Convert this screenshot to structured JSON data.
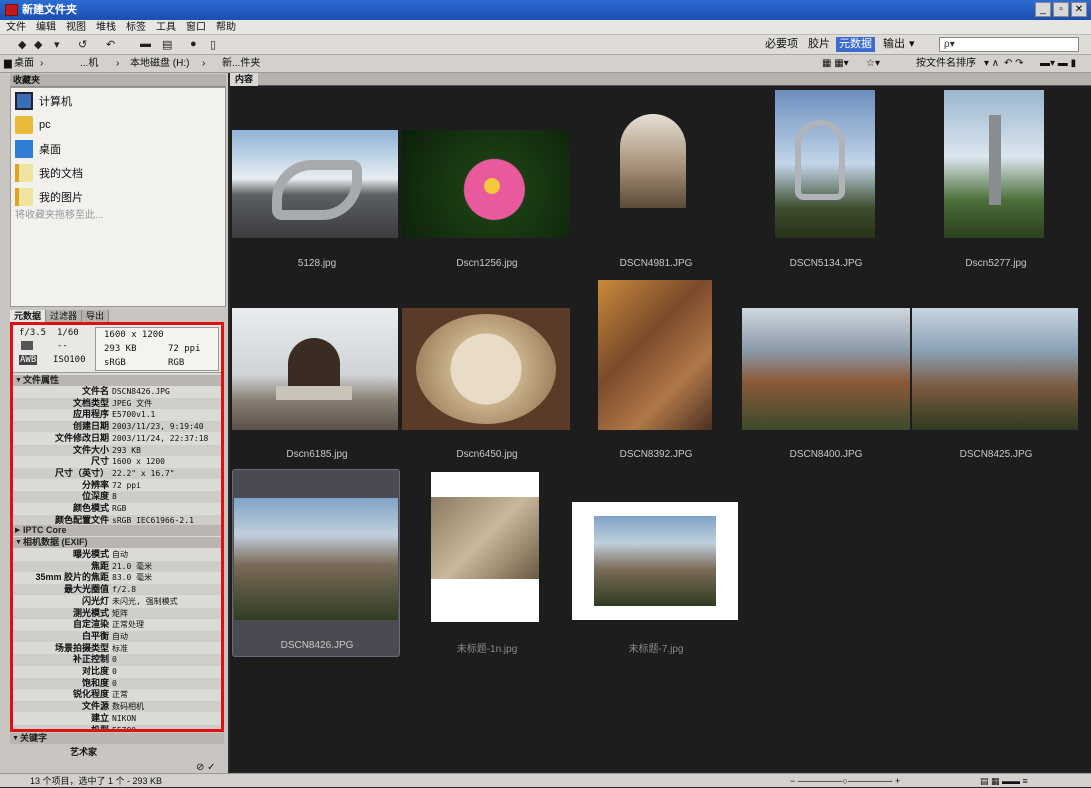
{
  "window": {
    "title": "新建文件夹"
  },
  "menu": [
    "文件",
    "编辑",
    "视图",
    "堆栈",
    "标签",
    "工具",
    "窗口",
    "帮助"
  ],
  "workspaces": [
    {
      "label": "必要项",
      "active": false
    },
    {
      "label": "胶片",
      "active": false
    },
    {
      "label": "元数据",
      "active": true
    },
    {
      "label": "输出",
      "active": false
    }
  ],
  "sort_label": "按文件名排序",
  "path": [
    "桌面",
    "...机",
    "本地磁盘 (H:)",
    "新...件夹"
  ],
  "favorites": {
    "title": "收藏夹",
    "items": [
      {
        "label": "计算机",
        "icon": "computer-icon"
      },
      {
        "label": "pc",
        "icon": "folder-icon"
      },
      {
        "label": "桌面",
        "icon": "desktop-icon"
      },
      {
        "label": "我的文档",
        "icon": "documents-icon"
      },
      {
        "label": "我的图片",
        "icon": "pictures-icon"
      }
    ],
    "hint": "将收藏夹拖移至此..."
  },
  "meta_tabs": [
    {
      "label": "元数据",
      "active": true
    },
    {
      "label": "过滤器",
      "active": false
    },
    {
      "label": "导出",
      "active": false
    }
  ],
  "camera_summary": {
    "aperture": "f/3.5",
    "shutter": "1/60",
    "dash": "--",
    "wb": "AWB",
    "iso": "ISO100",
    "dims": "1600 x 1200",
    "size": "293 KB",
    "ppi": "72 ppi",
    "colorspace": "sRGB",
    "mode": "RGB"
  },
  "file_props": {
    "title": "文件属性",
    "rows": [
      {
        "k": "文件名",
        "v": "DSCN8426.JPG"
      },
      {
        "k": "文档类型",
        "v": "JPEG 文件"
      },
      {
        "k": "应用程序",
        "v": "E5700v1.1"
      },
      {
        "k": "创建日期",
        "v": "2003/11/23, 9:19:40"
      },
      {
        "k": "文件修改日期",
        "v": "2003/11/24, 22:37:18"
      },
      {
        "k": "文件大小",
        "v": "293 KB"
      },
      {
        "k": "尺寸",
        "v": "1600 x 1200"
      },
      {
        "k": "尺寸（英寸）",
        "v": "22.2\" x 16.7\""
      },
      {
        "k": "分辨率",
        "v": "72 ppi"
      },
      {
        "k": "位深度",
        "v": "8"
      },
      {
        "k": "颜色模式",
        "v": "RGB"
      },
      {
        "k": "颜色配置文件",
        "v": "sRGB IEC61966-2.1"
      }
    ]
  },
  "iptc": {
    "title": "IPTC Core"
  },
  "exif": {
    "title": "相机数据 (EXIF)",
    "rows": [
      {
        "k": "曝光模式",
        "v": "自动"
      },
      {
        "k": "焦距",
        "v": "21.0 毫米"
      },
      {
        "k": "35mm 胶片的焦距",
        "v": "83.0 毫米"
      },
      {
        "k": "最大光圈值",
        "v": "f/2.8"
      },
      {
        "k": "闪光灯",
        "v": "未闪光, 强制模式"
      },
      {
        "k": "测光模式",
        "v": "矩阵"
      },
      {
        "k": "自定渲染",
        "v": "正常处理"
      },
      {
        "k": "白平衡",
        "v": "自动"
      },
      {
        "k": "场景拍摄类型",
        "v": "标准"
      },
      {
        "k": "补正控制",
        "v": "0"
      },
      {
        "k": "对比度",
        "v": "0"
      },
      {
        "k": "饱和度",
        "v": "0"
      },
      {
        "k": "锐化程度",
        "v": "正常"
      },
      {
        "k": "文件源",
        "v": "数码相机"
      },
      {
        "k": "建立",
        "v": "NIKON"
      },
      {
        "k": "机型",
        "v": "E5700"
      }
    ]
  },
  "keywords": {
    "title": "关键字",
    "row": "艺术家"
  },
  "content_tab": "内容",
  "thumbnails": [
    {
      "name": "5128.jpg"
    },
    {
      "name": "Dscn1256.jpg"
    },
    {
      "name": "DSCN4981.JPG"
    },
    {
      "name": "DSCN5134.JPG"
    },
    {
      "name": "Dscn5277.jpg"
    },
    {
      "name": "Dscn6185.jpg"
    },
    {
      "name": "Dscn6450.jpg"
    },
    {
      "name": "DSCN8392.JPG"
    },
    {
      "name": "DSCN8400.JPG"
    },
    {
      "name": "DSCN8425.JPG"
    },
    {
      "name": "DSCN8426.JPG"
    },
    {
      "name": "未标题-1n.jpg"
    },
    {
      "name": "未标题-7.jpg"
    }
  ],
  "status": "13 个项目，选中了 1 个 - 293 KB"
}
